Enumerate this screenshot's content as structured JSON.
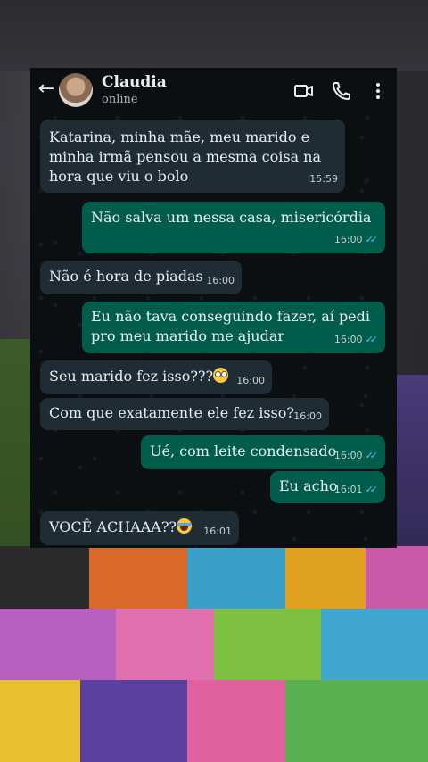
{
  "contact": {
    "name": "Claudia",
    "status": "online"
  },
  "header_icons": [
    "back-arrow-icon",
    "video-call-icon",
    "voice-call-icon",
    "more-options-icon"
  ],
  "messages": [
    {
      "direction": "in",
      "text": "Katarina, minha mãe, meu marido e minha irmã pensou a mesma coisa na hora que viu o bolo",
      "time": "15:59"
    },
    {
      "direction": "out",
      "text": "Não salva um nessa casa, misericórdia",
      "time": "16:00",
      "read": true
    },
    {
      "direction": "in",
      "text": "Não é hora de piadas",
      "time": "16:00"
    },
    {
      "direction": "out",
      "text": "Eu não tava conseguindo fazer, aí pedi pro meu marido me ajudar",
      "time": "16:00",
      "read": true
    },
    {
      "direction": "in",
      "text": "Seu marido fez isso???",
      "emoji": "face-with-rolling-eyes",
      "time": "16:00"
    },
    {
      "direction": "in",
      "text": "Com que exatamente ele fez isso?",
      "time": "16:00"
    },
    {
      "direction": "out",
      "text": "Ué, com leite condensado",
      "time": "16:00",
      "read": true
    },
    {
      "direction": "out",
      "text": "Eu acho",
      "time": "16:01",
      "read": true
    },
    {
      "direction": "in",
      "text": "VOCÊ ACHAAA??",
      "emoji": "loudly-crying-face",
      "time": "16:01"
    }
  ],
  "colors": {
    "incoming_bubble": "#1f2c33",
    "outgoing_bubble": "#005c4b",
    "read_ticks": "#53bdeb",
    "chat_background": "#0b0f12"
  }
}
